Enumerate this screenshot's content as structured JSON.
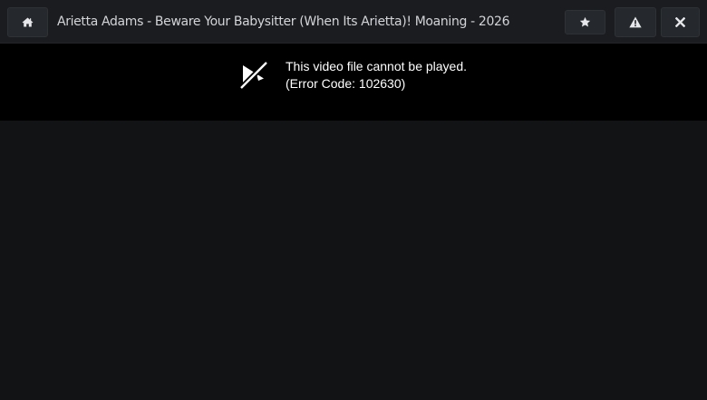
{
  "header": {
    "title": "Arietta Adams - Beware Your Babysitter (When Its Arietta)! Moaning - 2026",
    "buttons": {
      "home_icon": "home-icon",
      "favorite_icon": "star-icon",
      "report_icon": "warning-icon",
      "close_icon": "close-icon"
    }
  },
  "player": {
    "icon": "video-error-icon",
    "error_line1": "This video file cannot be played.",
    "error_line2": "(Error Code: 102630)"
  },
  "colors": {
    "background": "#121314",
    "topbar": "#1a1c1f",
    "player": "#000000",
    "text": "#ffffff"
  }
}
